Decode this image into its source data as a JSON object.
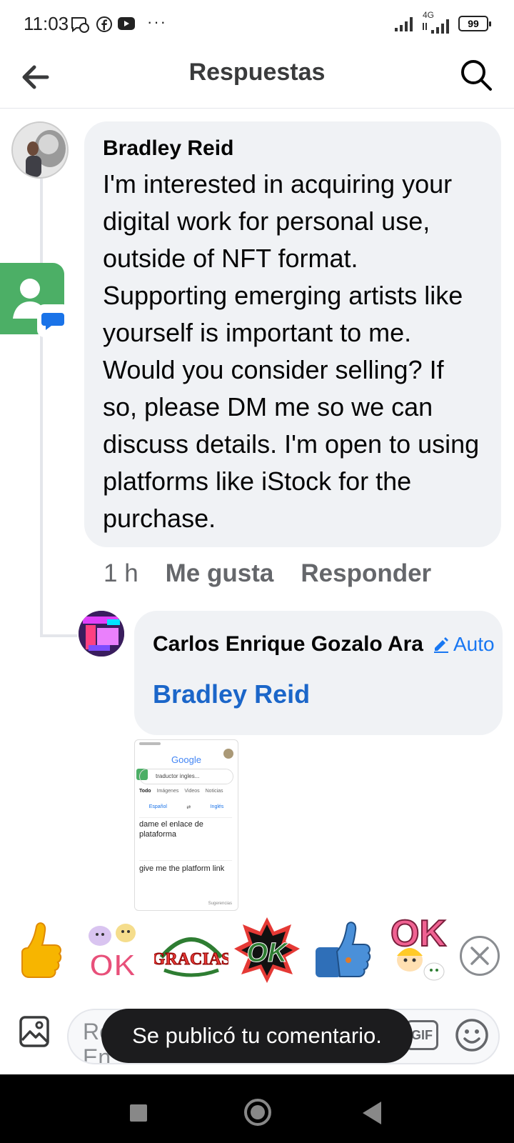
{
  "status_bar": {
    "time": "11:03",
    "battery": "99",
    "network": "4G",
    "more": "···"
  },
  "header": {
    "title": "Respuestas"
  },
  "comment_main": {
    "author": "Bradley Reid",
    "text": "I'm interested in acquiring your digital work for personal use, outside of NFT format. Supporting emerging artists like yourself is important to me. Would you consider selling? If so, please DM me so we can discuss details. I'm open to using platforms like iStock for the purchase.",
    "time": "1 h",
    "like_label": "Me gusta",
    "reply_label": "Responder"
  },
  "comment_reply": {
    "author": "Carlos Enrique Gozalo Ara",
    "translate_label": "Auto",
    "mention": "Bradley Reid"
  },
  "attachment": {
    "brand": "Google",
    "search_text": "traductor ingles...",
    "tabs": [
      "Todo",
      "Imágenes",
      "Videos",
      "Noticias"
    ],
    "source_lang": "Español",
    "target_lang": "Inglés",
    "source_text": "dame el enlace de plataforma",
    "translated_text": "give me the platform link",
    "suggestions": "Sugerencias"
  },
  "stickers": [
    {
      "name": "thumbs-up-emoji"
    },
    {
      "name": "ok-birds-sticker",
      "text": "OK"
    },
    {
      "name": "gracias-sticker",
      "text": "GRACIAS"
    },
    {
      "name": "ok-burst-sticker",
      "text": "OK"
    },
    {
      "name": "robot-thumbs-sticker"
    },
    {
      "name": "ok-girl-sticker",
      "text": "OK"
    }
  ],
  "composer": {
    "placeholder": "Re\nEn",
    "gif_label": "GIF"
  },
  "toast": {
    "message": "Se publicó tu comentario."
  },
  "colors": {
    "accent": "#1877f2",
    "mention": "#1b66c9",
    "bubble": "#f0f2f5",
    "meta": "#65676b"
  }
}
